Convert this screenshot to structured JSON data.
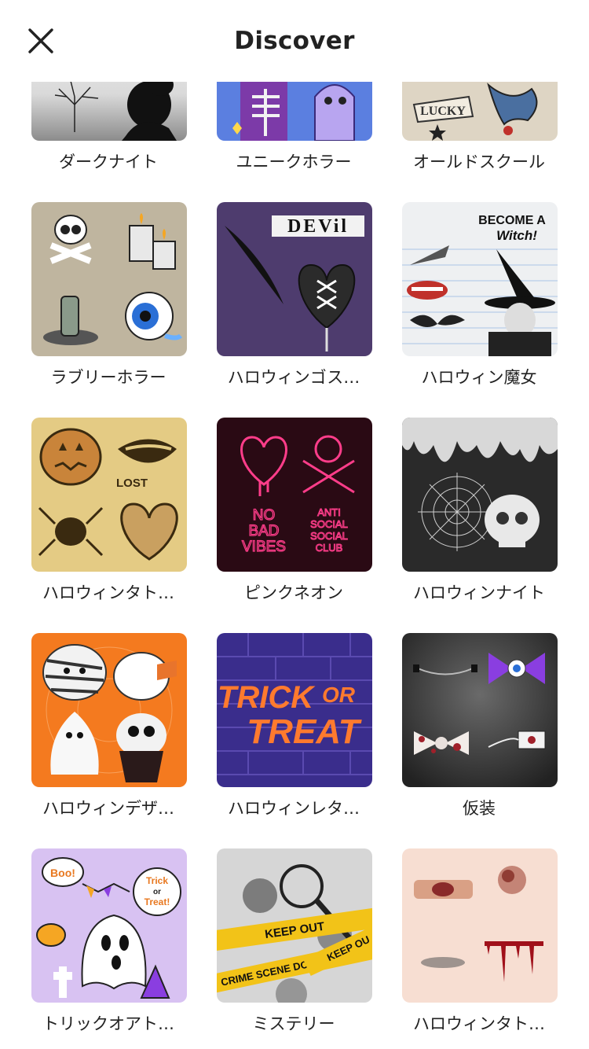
{
  "header": {
    "title": "Discover",
    "close_icon": "close-icon"
  },
  "items": [
    {
      "label": "ダークナイト"
    },
    {
      "label": "ユニークホラー"
    },
    {
      "label": "オールドスクール",
      "lucky_text": "LUCKY"
    },
    {
      "label": "ラブリーホラー"
    },
    {
      "label": "ハロウィンゴス…",
      "devil_text": "DEVil"
    },
    {
      "label": "ハロウィン魔女",
      "witch_line1": "BECOME A",
      "witch_line2": "Witch!"
    },
    {
      "label": "ハロウィンタト…",
      "lost_text": "LOST"
    },
    {
      "label": "ピンクネオン",
      "neon_left": [
        "NO",
        "BAD",
        "VIBES"
      ],
      "neon_right": [
        "ANTI",
        "SOCIAL",
        "SOCIAL",
        "CLUB"
      ]
    },
    {
      "label": "ハロウィンナイト"
    },
    {
      "label": "ハロウィンデザ…"
    },
    {
      "label": "ハロウィンレタ…",
      "trick_line1": "TRICK",
      "trick_or": "OR",
      "trick_line2": "TREAT"
    },
    {
      "label": "仮装"
    },
    {
      "label": "トリックオアト…",
      "boo_text": "Boo!",
      "bubble_line1": "Trick",
      "bubble_line2": "or",
      "bubble_line3": "Treat!"
    },
    {
      "label": "ミステリー",
      "tape1_text": "KEEP OUT",
      "tape2_text": "CRIME SCENE DO",
      "tape3_text": "KEEP OU"
    },
    {
      "label": "ハロウィンタト…"
    }
  ]
}
